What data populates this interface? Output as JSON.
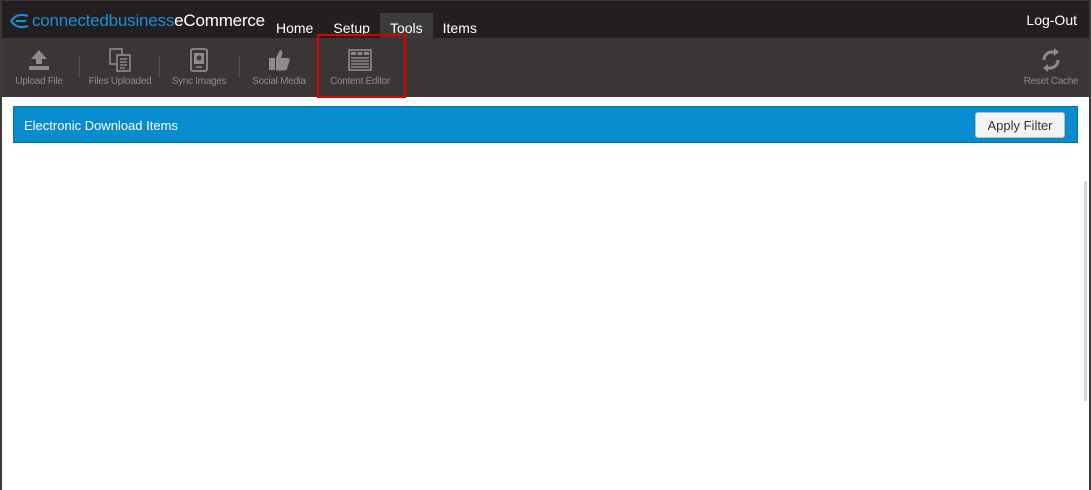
{
  "header": {
    "logo_part1": "connectedbusiness",
    "logo_part2": "eCommerce",
    "nav": [
      {
        "label": "Home"
      },
      {
        "label": "Setup"
      },
      {
        "label": "Tools"
      },
      {
        "label": "Items"
      }
    ],
    "logout": "Log-Out"
  },
  "toolbar": {
    "items": [
      {
        "label": "Upload File",
        "icon": "upload-icon"
      },
      {
        "label": "Files Uploaded",
        "icon": "files-icon"
      },
      {
        "label": "Sync Images",
        "icon": "image-icon"
      },
      {
        "label": "Social Media",
        "icon": "thumbs-up-icon"
      },
      {
        "label": "Content Editor",
        "icon": "content-editor-icon"
      }
    ],
    "reset": {
      "label": "Reset Cache",
      "icon": "refresh-icon"
    }
  },
  "filter": {
    "title": "Electronic Download Items",
    "apply_label": "Apply Filter"
  },
  "colors": {
    "header_bg": "#231f20",
    "toolbar_bg": "#3a3637",
    "brand_blue": "#1d8fd6",
    "filter_bar": "#078ccd",
    "highlight": "#e00000"
  }
}
